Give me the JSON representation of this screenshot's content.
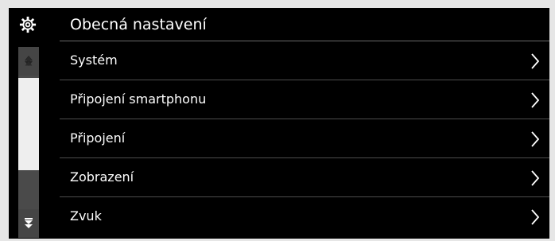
{
  "header": {
    "icon": "gear-icon",
    "title": "Obecná nastavení"
  },
  "menu": {
    "items": [
      {
        "label": "Systém",
        "icon": "chevron-right-icon"
      },
      {
        "label": "Připojení smartphonu",
        "icon": "chevron-right-icon"
      },
      {
        "label": "Připojení",
        "icon": "chevron-right-icon"
      },
      {
        "label": "Zobrazení",
        "icon": "chevron-right-icon"
      },
      {
        "label": "Zvuk",
        "icon": "chevron-right-icon"
      }
    ]
  },
  "scrollbar": {
    "up_icon": "scroll-up-icon",
    "down_icon": "scroll-down-icon",
    "thumb_position": 0.0
  },
  "colors": {
    "background": "#000000",
    "text": "#ffffff",
    "divider": "#4d4d4d",
    "scroll_thumb": "#eeeeee",
    "scroll_track": "#4a4a4a"
  }
}
